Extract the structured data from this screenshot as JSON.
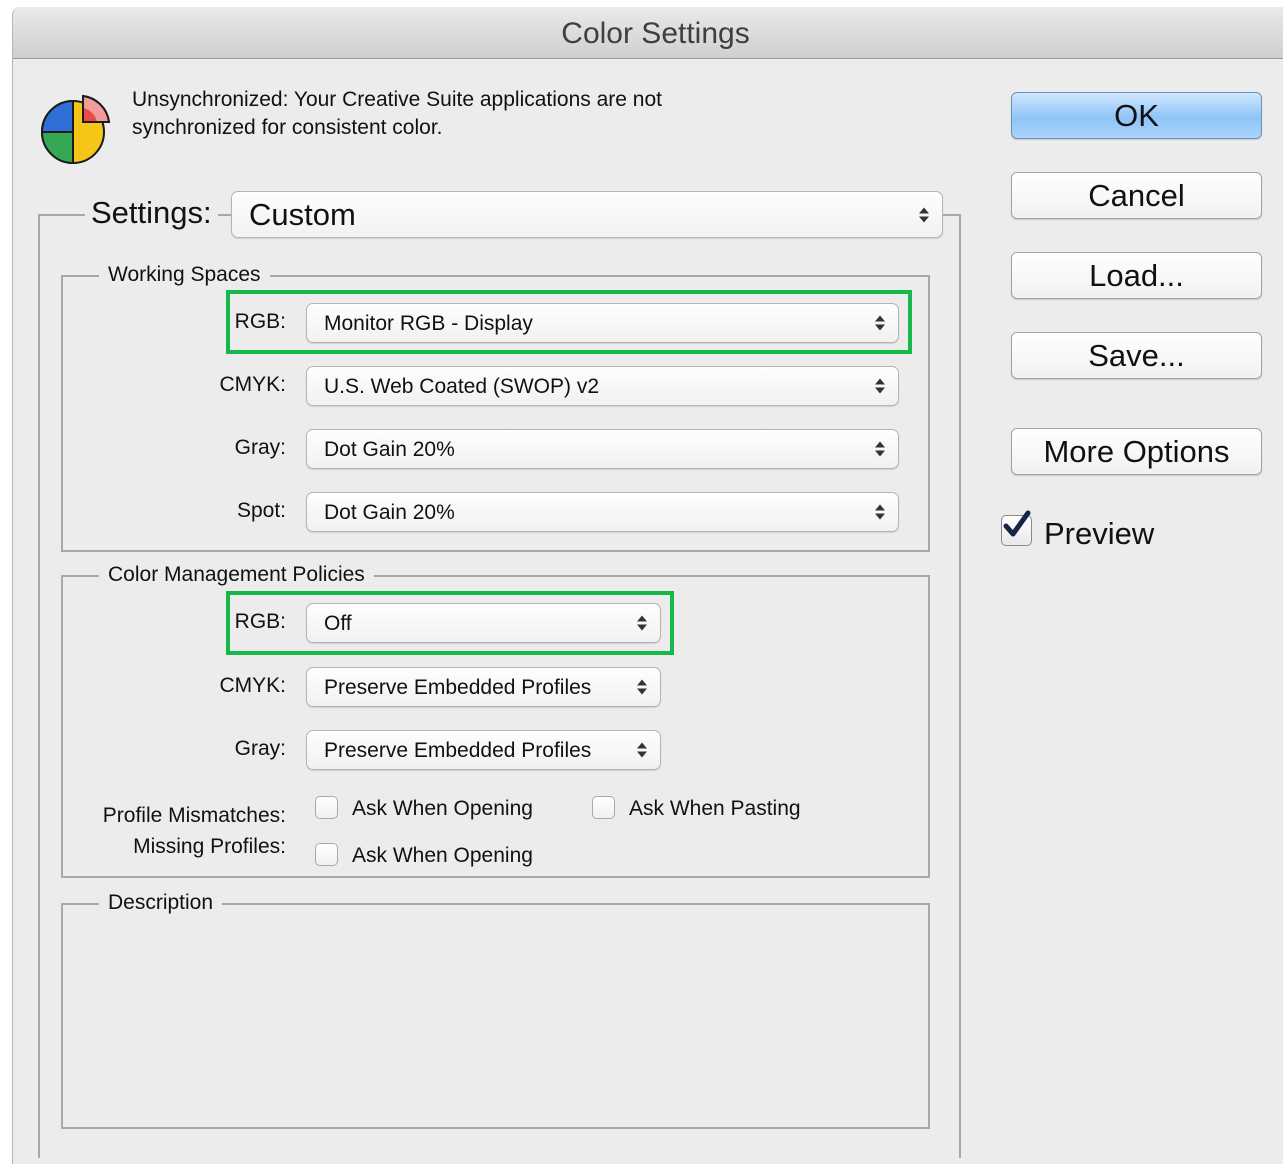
{
  "window": {
    "title": "Color Settings"
  },
  "message": {
    "line1": "Unsynchronized: Your Creative Suite applications are not",
    "line2": "synchronized for consistent color."
  },
  "settings": {
    "label": "Settings:",
    "value": "Custom"
  },
  "working_spaces": {
    "title": "Working Spaces",
    "rows": [
      {
        "label": "RGB:",
        "value": "Monitor RGB - Display"
      },
      {
        "label": "CMYK:",
        "value": "U.S. Web Coated (SWOP) v2"
      },
      {
        "label": "Gray:",
        "value": "Dot Gain 20%"
      },
      {
        "label": "Spot:",
        "value": "Dot Gain 20%"
      }
    ]
  },
  "policies": {
    "title": "Color Management Policies",
    "rows": [
      {
        "label": "RGB:",
        "value": "Off"
      },
      {
        "label": "CMYK:",
        "value": "Preserve Embedded Profiles"
      },
      {
        "label": "Gray:",
        "value": "Preserve Embedded Profiles"
      }
    ],
    "profile_mismatches_label": "Profile Mismatches:",
    "missing_profiles_label": "Missing Profiles:",
    "ask_opening_label": "Ask When Opening",
    "ask_pasting_label": "Ask When Pasting",
    "missing_ask_opening_label": "Ask When Opening",
    "ask_opening_checked": false,
    "ask_pasting_checked": false,
    "missing_ask_opening_checked": false
  },
  "description": {
    "title": "Description",
    "text": ""
  },
  "buttons": {
    "ok": "OK",
    "cancel": "Cancel",
    "load": "Load...",
    "save": "Save...",
    "more_options": "More Options"
  },
  "preview": {
    "label": "Preview",
    "checked": true
  },
  "colors": {
    "highlight": "#16b84a",
    "ok_button": "#8fc4f7",
    "background": "#ececec"
  }
}
